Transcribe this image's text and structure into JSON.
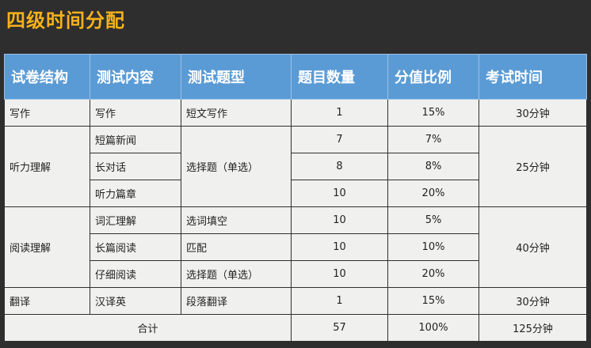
{
  "title": "四级时间分配",
  "headers": [
    "试卷结构",
    "测试内容",
    "测试题型",
    "题目数量",
    "分值比例",
    "考试时间"
  ],
  "sections": {
    "writing": {
      "name": "写作",
      "rows": [
        {
          "content": "写作",
          "type": "短文写作",
          "count": "1",
          "ratio": "15%"
        }
      ],
      "time": "30分钟"
    },
    "listening": {
      "name": "听力理解",
      "type": "选择题（单选）",
      "rows": [
        {
          "content": "短篇新闻",
          "count": "7",
          "ratio": "7%"
        },
        {
          "content": "长对话",
          "count": "8",
          "ratio": "8%"
        },
        {
          "content": "听力篇章",
          "count": "10",
          "ratio": "20%"
        }
      ],
      "time": "25分钟"
    },
    "reading": {
      "name": "阅读理解",
      "rows": [
        {
          "content": "词汇理解",
          "type": "选词填空",
          "count": "10",
          "ratio": "5%"
        },
        {
          "content": "长篇阅读",
          "type": "匹配",
          "count": "10",
          "ratio": "10%"
        },
        {
          "content": "仔细阅读",
          "type": "选择题（单选）",
          "count": "10",
          "ratio": "20%"
        }
      ],
      "time": "40分钟"
    },
    "translation": {
      "name": "翻译",
      "rows": [
        {
          "content": "汉译英",
          "type": "段落翻译",
          "count": "1",
          "ratio": "15%"
        }
      ],
      "time": "30分钟"
    }
  },
  "total": {
    "label": "合计",
    "count": "57",
    "ratio": "100%",
    "time": "125分钟"
  }
}
